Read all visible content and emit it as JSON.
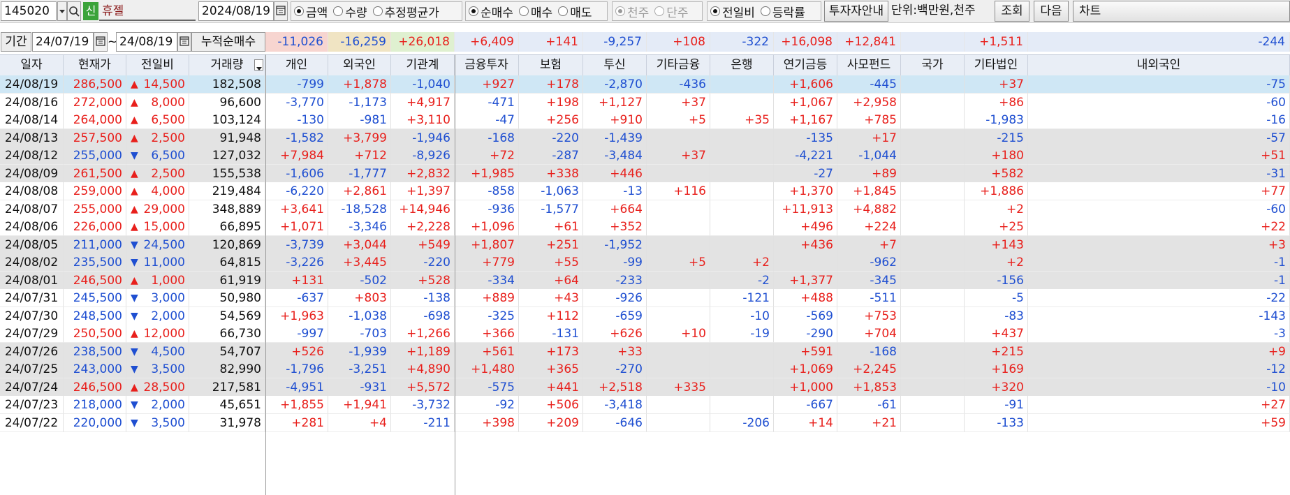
{
  "toolbar": {
    "code": "145020",
    "new_badge": "신",
    "stock_name": "휴젤",
    "date": "2024/08/19",
    "measure_options": [
      "금액",
      "수량",
      "추정평균가"
    ],
    "measure_selected": 0,
    "trade_options": [
      "순매수",
      "매수",
      "매도"
    ],
    "trade_selected": 0,
    "unit_options": [
      "천주",
      "단주"
    ],
    "unit_selected": 0,
    "change_options": [
      "전일비",
      "등락률"
    ],
    "change_selected": 0,
    "investor_info_button": "투자자안내",
    "unit_label": "단위:백만원,천주",
    "search_button": "조회",
    "next_button": "다음",
    "chart_button": "차트"
  },
  "period": {
    "label": "기간",
    "start": "24/07/19",
    "tilde": "~",
    "end": "24/08/19",
    "cumulative_label": "누적순매수",
    "sums": [
      "-11,026",
      "-16,259",
      "+26,018",
      "+6,409",
      "+141",
      "-9,257",
      "+108",
      "-322",
      "+16,098",
      "+12,841",
      "",
      "+1,511",
      "-244"
    ]
  },
  "columns": [
    "일자",
    "현재가",
    "전일비",
    "거래량",
    "개인",
    "외국인",
    "기관계",
    "금융투자",
    "보험",
    "투신",
    "기타금융",
    "은행",
    "연기금등",
    "사모펀드",
    "국가",
    "기타법인",
    "내외국인"
  ],
  "rows": [
    {
      "date": "24/08/19",
      "price": "286,500",
      "dir": "up",
      "change": "14,500",
      "volume": "182,508",
      "vals": [
        "-799",
        "+1,878",
        "-1,040",
        "+927",
        "+178",
        "-2,870",
        "-436",
        "",
        "+1,606",
        "-445",
        "",
        "+37",
        "-75"
      ]
    },
    {
      "date": "24/08/16",
      "price": "272,000",
      "dir": "up",
      "change": "8,000",
      "volume": "96,600",
      "vals": [
        "-3,770",
        "-1,173",
        "+4,917",
        "-471",
        "+198",
        "+1,127",
        "+37",
        "",
        "+1,067",
        "+2,958",
        "",
        "+86",
        "-60"
      ]
    },
    {
      "date": "24/08/14",
      "price": "264,000",
      "dir": "up",
      "change": "6,500",
      "volume": "103,124",
      "vals": [
        "-130",
        "-981",
        "+3,110",
        "-47",
        "+256",
        "+910",
        "+5",
        "+35",
        "+1,167",
        "+785",
        "",
        "-1,983",
        "-16"
      ]
    },
    {
      "date": "24/08/13",
      "price": "257,500",
      "dir": "up",
      "change": "2,500",
      "volume": "91,948",
      "vals": [
        "-1,582",
        "+3,799",
        "-1,946",
        "-168",
        "-220",
        "-1,439",
        "",
        "",
        "-135",
        "+17",
        "",
        "-215",
        "-57"
      ]
    },
    {
      "date": "24/08/12",
      "price": "255,000",
      "dir": "down",
      "change": "6,500",
      "volume": "127,032",
      "vals": [
        "+7,984",
        "+712",
        "-8,926",
        "+72",
        "-287",
        "-3,484",
        "+37",
        "",
        "-4,221",
        "-1,044",
        "",
        "+180",
        "+51"
      ]
    },
    {
      "date": "24/08/09",
      "price": "261,500",
      "dir": "up",
      "change": "2,500",
      "volume": "155,538",
      "vals": [
        "-1,606",
        "-1,777",
        "+2,832",
        "+1,985",
        "+338",
        "+446",
        "",
        "",
        "-27",
        "+89",
        "",
        "+582",
        "-31"
      ]
    },
    {
      "date": "24/08/08",
      "price": "259,000",
      "dir": "up",
      "change": "4,000",
      "volume": "219,484",
      "vals": [
        "-6,220",
        "+2,861",
        "+1,397",
        "-858",
        "-1,063",
        "-13",
        "+116",
        "",
        "+1,370",
        "+1,845",
        "",
        "+1,886",
        "+77"
      ]
    },
    {
      "date": "24/08/07",
      "price": "255,000",
      "dir": "up",
      "change": "29,000",
      "volume": "348,889",
      "vals": [
        "+3,641",
        "-18,528",
        "+14,946",
        "-936",
        "-1,577",
        "+664",
        "",
        "",
        "+11,913",
        "+4,882",
        "",
        "+2",
        "-60"
      ]
    },
    {
      "date": "24/08/06",
      "price": "226,000",
      "dir": "up",
      "change": "15,000",
      "volume": "66,895",
      "vals": [
        "+1,071",
        "-3,346",
        "+2,228",
        "+1,096",
        "+61",
        "+352",
        "",
        "",
        "+496",
        "+224",
        "",
        "+25",
        "+22"
      ]
    },
    {
      "date": "24/08/05",
      "price": "211,000",
      "dir": "down",
      "change": "24,500",
      "volume": "120,869",
      "vals": [
        "-3,739",
        "+3,044",
        "+549",
        "+1,807",
        "+251",
        "-1,952",
        "",
        "",
        "+436",
        "+7",
        "",
        "+143",
        "+3"
      ]
    },
    {
      "date": "24/08/02",
      "price": "235,500",
      "dir": "down",
      "change": "11,000",
      "volume": "64,815",
      "vals": [
        "-3,226",
        "+3,445",
        "-220",
        "+779",
        "+55",
        "-99",
        "+5",
        "+2",
        "",
        "-962",
        "",
        "+2",
        "-1"
      ]
    },
    {
      "date": "24/08/01",
      "price": "246,500",
      "dir": "up",
      "change": "1,000",
      "volume": "61,919",
      "vals": [
        "+131",
        "-502",
        "+528",
        "-334",
        "+64",
        "-233",
        "",
        "-2",
        "+1,377",
        "-345",
        "",
        "-156",
        "-1"
      ]
    },
    {
      "date": "24/07/31",
      "price": "245,500",
      "dir": "down",
      "change": "3,000",
      "volume": "50,980",
      "vals": [
        "-637",
        "+803",
        "-138",
        "+889",
        "+43",
        "-926",
        "",
        "-121",
        "+488",
        "-511",
        "",
        "-5",
        "-22"
      ]
    },
    {
      "date": "24/07/30",
      "price": "248,500",
      "dir": "down",
      "change": "2,000",
      "volume": "54,569",
      "vals": [
        "+1,963",
        "-1,038",
        "-698",
        "-325",
        "+112",
        "-659",
        "",
        "-10",
        "-569",
        "+753",
        "",
        "-83",
        "-143"
      ]
    },
    {
      "date": "24/07/29",
      "price": "250,500",
      "dir": "up",
      "change": "12,000",
      "volume": "66,730",
      "vals": [
        "-997",
        "-703",
        "+1,266",
        "+366",
        "-131",
        "+626",
        "+10",
        "-19",
        "-290",
        "+704",
        "",
        "+437",
        "-3"
      ]
    },
    {
      "date": "24/07/26",
      "price": "238,500",
      "dir": "down",
      "change": "4,500",
      "volume": "54,707",
      "vals": [
        "+526",
        "-1,939",
        "+1,189",
        "+561",
        "+173",
        "+33",
        "",
        "",
        "+591",
        "-168",
        "",
        "+215",
        "+9"
      ]
    },
    {
      "date": "24/07/25",
      "price": "243,000",
      "dir": "down",
      "change": "3,500",
      "volume": "82,990",
      "vals": [
        "-1,796",
        "-3,251",
        "+4,890",
        "+1,480",
        "+365",
        "-270",
        "",
        "",
        "+1,069",
        "+2,245",
        "",
        "+169",
        "-12"
      ]
    },
    {
      "date": "24/07/24",
      "price": "246,500",
      "dir": "up",
      "change": "28,500",
      "volume": "217,581",
      "vals": [
        "-4,951",
        "-931",
        "+5,572",
        "-575",
        "+441",
        "+2,518",
        "+335",
        "",
        "+1,000",
        "+1,853",
        "",
        "+320",
        "-10"
      ]
    },
    {
      "date": "24/07/23",
      "price": "218,000",
      "dir": "down",
      "change": "2,000",
      "volume": "45,651",
      "vals": [
        "+1,855",
        "+1,941",
        "-3,732",
        "-92",
        "+506",
        "-3,418",
        "",
        "",
        "-667",
        "-61",
        "",
        "-91",
        "+27"
      ]
    },
    {
      "date": "24/07/22",
      "price": "220,000",
      "dir": "down",
      "change": "3,500",
      "volume": "31,978",
      "vals": [
        "+281",
        "+4",
        "-211",
        "+398",
        "+209",
        "-646",
        "",
        "-206",
        "+14",
        "+21",
        "",
        "-133",
        "+59"
      ]
    }
  ],
  "colors": {
    "up": "#e8201c",
    "down": "#1f4fd1",
    "selected_row": "#cfe7f5",
    "shaded_row": "#e3e3e3",
    "sum_individual": "#f7d5d0",
    "sum_foreign": "#f0e4c3",
    "sum_institution": "#dff0d0",
    "sum_sub": "#e4ebf7"
  },
  "icons": {
    "dropdown": "chevron-down-icon",
    "search": "search-icon",
    "calendar": "calendar-icon",
    "sort": "sort-down-icon"
  }
}
